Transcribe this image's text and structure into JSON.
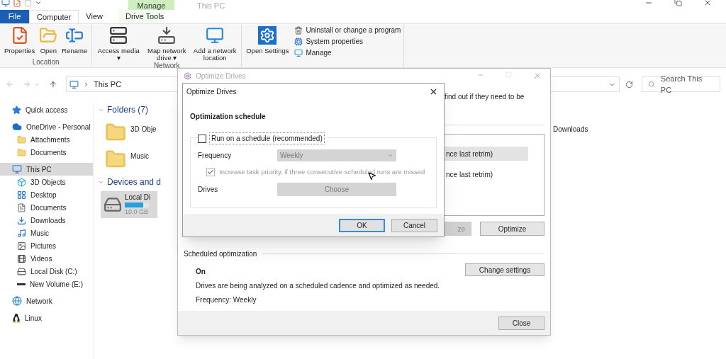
{
  "explorer": {
    "title": "This PC",
    "contextual_group": "Manage",
    "tabs": [
      {
        "label": "File",
        "selected": false
      },
      {
        "label": "Computer",
        "selected": true
      },
      {
        "label": "View",
        "selected": false
      },
      {
        "label": "Drive Tools",
        "selected": false
      }
    ],
    "ribbon_groups": [
      {
        "label": "Location",
        "buttons": [
          "Properties",
          "Open",
          "Rename"
        ]
      },
      {
        "label": "Network",
        "buttons": [
          "Access media ▾",
          "Map network drive ▾",
          "Add a network location"
        ]
      },
      {
        "buttons": [
          "Open Settings"
        ],
        "small_buttons": [
          "Uninstall or change a program",
          "System properties",
          "Manage"
        ]
      }
    ],
    "address": "This PC",
    "search": {
      "placeholder": "Search This PC"
    },
    "nav": [
      {
        "label": "Quick access",
        "selected": false
      },
      {
        "label": "OneDrive - Personal",
        "selected": false,
        "children": [
          {
            "label": "Attachments",
            "selected": false
          },
          {
            "label": "Documents",
            "selected": false
          }
        ]
      },
      {
        "label": "This PC",
        "selected": true,
        "children": [
          {
            "label": "3D Objects",
            "selected": false
          },
          {
            "label": "Desktop",
            "selected": false
          },
          {
            "label": "Documents",
            "selected": false
          },
          {
            "label": "Downloads",
            "selected": false
          },
          {
            "label": "Music",
            "selected": false
          },
          {
            "label": "Pictures",
            "selected": false
          },
          {
            "label": "Videos",
            "selected": false
          },
          {
            "label": "Local Disk (C:)",
            "selected": false
          },
          {
            "label": "New Volume (E:)",
            "selected": false
          }
        ]
      },
      {
        "label": "Network",
        "selected": false
      },
      {
        "label": "Linux",
        "selected": false
      }
    ],
    "folders": {
      "heading": "Folders (7)",
      "items": [
        "3D Obje",
        "Downloads",
        "Music"
      ]
    },
    "devices": {
      "heading": "Devices and d",
      "drive": {
        "name": "Local Di",
        "size": "10.0 GB",
        "level": 0.75
      }
    }
  },
  "optimize_window": {
    "title": "Optimize Drives",
    "intro": "find out if they need to be",
    "drives": [
      {
        "status": "nce last retrim)",
        "selected": true
      },
      {
        "status": "nce last retrim)",
        "selected": false
      }
    ],
    "buttons": [
      {
        "label": "ze",
        "disabled": true
      },
      {
        "label": "Optimize",
        "disabled": false
      }
    ],
    "scheduled": {
      "heading": "Scheduled optimization",
      "state": "On",
      "description": "Drives are being analyzed on a scheduled cadence and optimized as needed.",
      "frequency": "Frequency: Weekly",
      "button": "Change settings"
    },
    "close": "Close"
  },
  "schedule_dialog": {
    "title": "Optimize Drives",
    "heading": "Optimization schedule",
    "run_on_schedule": {
      "label": "Run on a schedule (recommended)",
      "checked": false
    },
    "frequency": {
      "label": "Frequency",
      "value": "Weekly",
      "disabled": true
    },
    "increase_priority": {
      "label": "Increase task priority, if three consecutive scheduled runs are missed",
      "checked": true,
      "disabled": true
    },
    "drives": {
      "label": "Drives",
      "button": "Choose",
      "disabled": true
    },
    "buttons": [
      {
        "label": "OK",
        "default": true
      },
      {
        "label": "Cancel",
        "default": false
      }
    ]
  }
}
